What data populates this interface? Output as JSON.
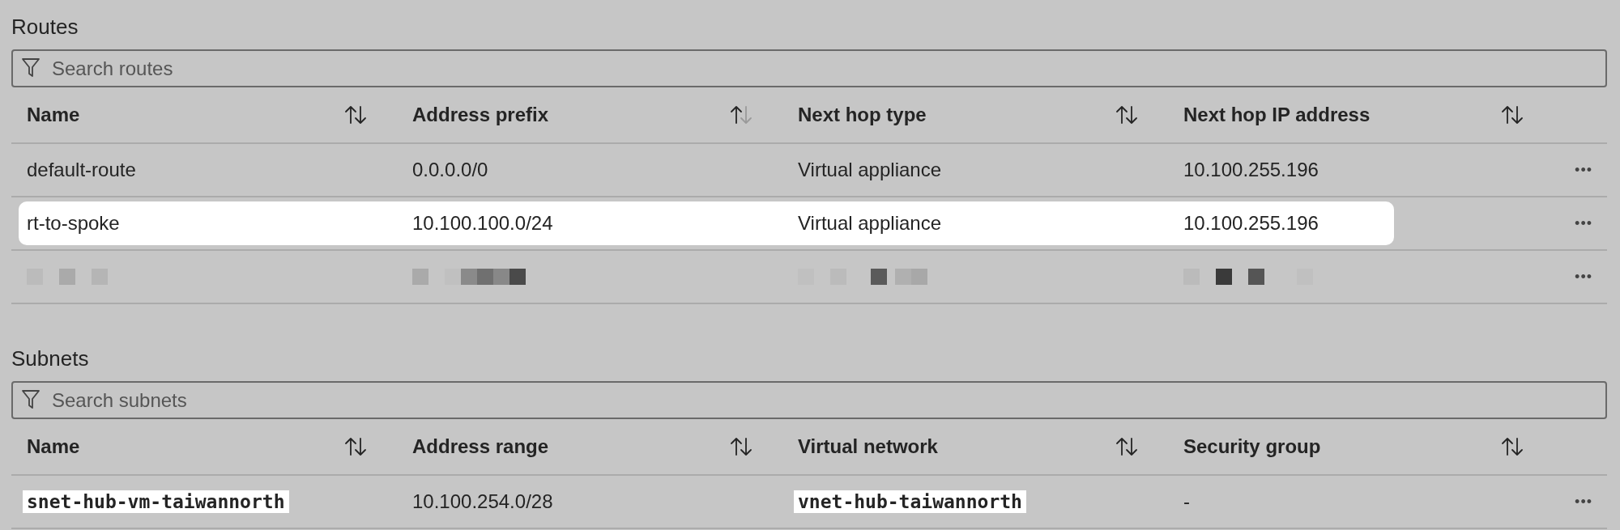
{
  "sections": [
    {
      "title": "Routes",
      "search": {
        "placeholder": "Search routes"
      },
      "columns": [
        {
          "label": "Name",
          "down_arrow_dimmed": false
        },
        {
          "label": "Address prefix",
          "down_arrow_dimmed": true
        },
        {
          "label": "Next hop type",
          "down_arrow_dimmed": false
        },
        {
          "label": "Next hop IP address",
          "down_arrow_dimmed": false
        }
      ],
      "rows": [
        {
          "kind": "plain",
          "highlighted": false,
          "cells": [
            {
              "text": "default-route",
              "kind": "text"
            },
            {
              "text": "0.0.0.0/0",
              "kind": "text"
            },
            {
              "text": "Virtual appliance",
              "kind": "text"
            },
            {
              "text": "10.100.255.196",
              "kind": "text"
            }
          ],
          "menu": "•••"
        },
        {
          "kind": "plain",
          "highlighted": true,
          "cells": [
            {
              "text": "rt-to-spoke",
              "kind": "text"
            },
            {
              "text": "10.100.100.0/24",
              "kind": "text"
            },
            {
              "text": "Virtual appliance",
              "kind": "text"
            },
            {
              "text": "10.100.255.196",
              "kind": "text"
            }
          ],
          "menu": "•••"
        },
        {
          "kind": "redacted",
          "highlighted": false,
          "menu": "•••"
        }
      ]
    },
    {
      "title": "Subnets",
      "search": {
        "placeholder": "Search subnets"
      },
      "columns": [
        {
          "label": "Name",
          "down_arrow_dimmed": false
        },
        {
          "label": "Address range",
          "down_arrow_dimmed": false
        },
        {
          "label": "Virtual network",
          "down_arrow_dimmed": false
        },
        {
          "label": "Security group",
          "down_arrow_dimmed": false
        }
      ],
      "rows": [
        {
          "kind": "plain",
          "highlighted": false,
          "cells": [
            {
              "text": "snet-hub-vm-taiwannorth",
              "kind": "code"
            },
            {
              "text": "10.100.254.0/28",
              "kind": "text"
            },
            {
              "text": "vnet-hub-taiwannorth",
              "kind": "code"
            },
            {
              "text": "-",
              "kind": "text"
            }
          ],
          "menu": "•••"
        }
      ]
    }
  ]
}
